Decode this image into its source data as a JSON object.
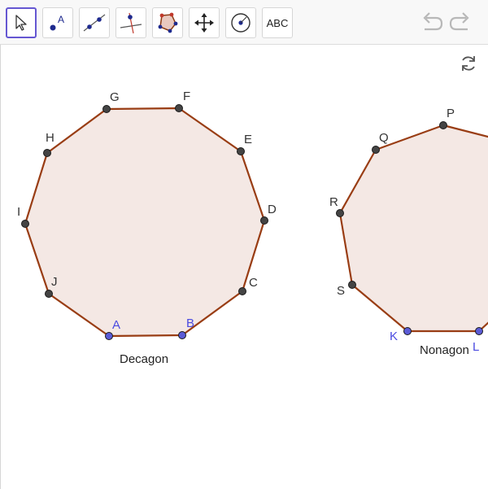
{
  "toolbar": {
    "tools": [
      {
        "name": "move-tool",
        "icon": "cursor-arrow-icon",
        "selected": true
      },
      {
        "name": "point-tool",
        "icon": "point-with-label-icon"
      },
      {
        "name": "line-tool",
        "icon": "line-through-two-points-icon"
      },
      {
        "name": "perpendicular-line-tool",
        "icon": "perpendicular-line-icon"
      },
      {
        "name": "polygon-tool",
        "icon": "polygon-icon"
      },
      {
        "name": "move-graphics-view-tool",
        "icon": "four-way-arrow-icon"
      },
      {
        "name": "circle-tool",
        "icon": "circle-with-center-icon"
      },
      {
        "name": "text-tool",
        "icon": "text-icon",
        "label": "ABC"
      }
    ],
    "undo_icon": "undo-icon",
    "redo_icon": "redo-icon"
  },
  "canvas": {
    "refresh_icon": "refresh-icon",
    "colors": {
      "fill": "#f4e8e4",
      "edge": "#993d14",
      "free_point": "#5b5bd6",
      "dependent_point": "#444444",
      "free_label": "#4a4ae0",
      "point_label": "#333333",
      "accent": "#6557d2"
    },
    "decagon": {
      "caption": "Decagon",
      "points": [
        "A",
        "B",
        "C",
        "D",
        "E",
        "F",
        "G",
        "H",
        "I",
        "J"
      ]
    },
    "nonagon": {
      "caption": "Nonagon",
      "points": [
        "K",
        "L",
        "P",
        "Q",
        "R",
        "S"
      ]
    }
  }
}
